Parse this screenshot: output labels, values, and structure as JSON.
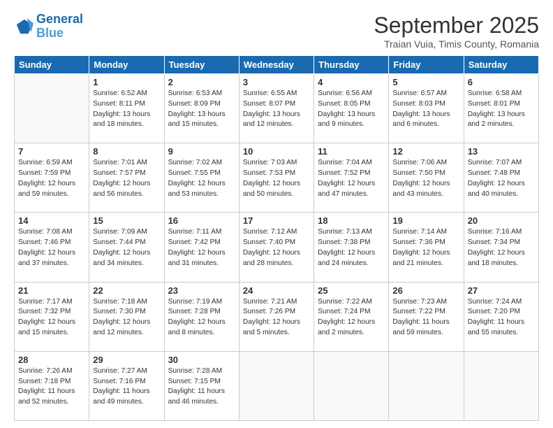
{
  "header": {
    "logo_line1": "General",
    "logo_line2": "Blue",
    "month": "September 2025",
    "location": "Traian Vuia, Timis County, Romania"
  },
  "weekdays": [
    "Sunday",
    "Monday",
    "Tuesday",
    "Wednesday",
    "Thursday",
    "Friday",
    "Saturday"
  ],
  "weeks": [
    [
      null,
      {
        "day": 1,
        "sunrise": "6:52 AM",
        "sunset": "8:11 PM",
        "daylight": "13 hours and 18 minutes."
      },
      {
        "day": 2,
        "sunrise": "6:53 AM",
        "sunset": "8:09 PM",
        "daylight": "13 hours and 15 minutes."
      },
      {
        "day": 3,
        "sunrise": "6:55 AM",
        "sunset": "8:07 PM",
        "daylight": "13 hours and 12 minutes."
      },
      {
        "day": 4,
        "sunrise": "6:56 AM",
        "sunset": "8:05 PM",
        "daylight": "13 hours and 9 minutes."
      },
      {
        "day": 5,
        "sunrise": "6:57 AM",
        "sunset": "8:03 PM",
        "daylight": "13 hours and 6 minutes."
      },
      {
        "day": 6,
        "sunrise": "6:58 AM",
        "sunset": "8:01 PM",
        "daylight": "13 hours and 2 minutes."
      }
    ],
    [
      {
        "day": 7,
        "sunrise": "6:59 AM",
        "sunset": "7:59 PM",
        "daylight": "12 hours and 59 minutes."
      },
      {
        "day": 8,
        "sunrise": "7:01 AM",
        "sunset": "7:57 PM",
        "daylight": "12 hours and 56 minutes."
      },
      {
        "day": 9,
        "sunrise": "7:02 AM",
        "sunset": "7:55 PM",
        "daylight": "12 hours and 53 minutes."
      },
      {
        "day": 10,
        "sunrise": "7:03 AM",
        "sunset": "7:53 PM",
        "daylight": "12 hours and 50 minutes."
      },
      {
        "day": 11,
        "sunrise": "7:04 AM",
        "sunset": "7:52 PM",
        "daylight": "12 hours and 47 minutes."
      },
      {
        "day": 12,
        "sunrise": "7:06 AM",
        "sunset": "7:50 PM",
        "daylight": "12 hours and 43 minutes."
      },
      {
        "day": 13,
        "sunrise": "7:07 AM",
        "sunset": "7:48 PM",
        "daylight": "12 hours and 40 minutes."
      }
    ],
    [
      {
        "day": 14,
        "sunrise": "7:08 AM",
        "sunset": "7:46 PM",
        "daylight": "12 hours and 37 minutes."
      },
      {
        "day": 15,
        "sunrise": "7:09 AM",
        "sunset": "7:44 PM",
        "daylight": "12 hours and 34 minutes."
      },
      {
        "day": 16,
        "sunrise": "7:11 AM",
        "sunset": "7:42 PM",
        "daylight": "12 hours and 31 minutes."
      },
      {
        "day": 17,
        "sunrise": "7:12 AM",
        "sunset": "7:40 PM",
        "daylight": "12 hours and 28 minutes."
      },
      {
        "day": 18,
        "sunrise": "7:13 AM",
        "sunset": "7:38 PM",
        "daylight": "12 hours and 24 minutes."
      },
      {
        "day": 19,
        "sunrise": "7:14 AM",
        "sunset": "7:36 PM",
        "daylight": "12 hours and 21 minutes."
      },
      {
        "day": 20,
        "sunrise": "7:16 AM",
        "sunset": "7:34 PM",
        "daylight": "12 hours and 18 minutes."
      }
    ],
    [
      {
        "day": 21,
        "sunrise": "7:17 AM",
        "sunset": "7:32 PM",
        "daylight": "12 hours and 15 minutes."
      },
      {
        "day": 22,
        "sunrise": "7:18 AM",
        "sunset": "7:30 PM",
        "daylight": "12 hours and 12 minutes."
      },
      {
        "day": 23,
        "sunrise": "7:19 AM",
        "sunset": "7:28 PM",
        "daylight": "12 hours and 8 minutes."
      },
      {
        "day": 24,
        "sunrise": "7:21 AM",
        "sunset": "7:26 PM",
        "daylight": "12 hours and 5 minutes."
      },
      {
        "day": 25,
        "sunrise": "7:22 AM",
        "sunset": "7:24 PM",
        "daylight": "12 hours and 2 minutes."
      },
      {
        "day": 26,
        "sunrise": "7:23 AM",
        "sunset": "7:22 PM",
        "daylight": "11 hours and 59 minutes."
      },
      {
        "day": 27,
        "sunrise": "7:24 AM",
        "sunset": "7:20 PM",
        "daylight": "11 hours and 55 minutes."
      }
    ],
    [
      {
        "day": 28,
        "sunrise": "7:26 AM",
        "sunset": "7:18 PM",
        "daylight": "11 hours and 52 minutes."
      },
      {
        "day": 29,
        "sunrise": "7:27 AM",
        "sunset": "7:16 PM",
        "daylight": "11 hours and 49 minutes."
      },
      {
        "day": 30,
        "sunrise": "7:28 AM",
        "sunset": "7:15 PM",
        "daylight": "11 hours and 46 minutes."
      },
      null,
      null,
      null,
      null
    ]
  ]
}
